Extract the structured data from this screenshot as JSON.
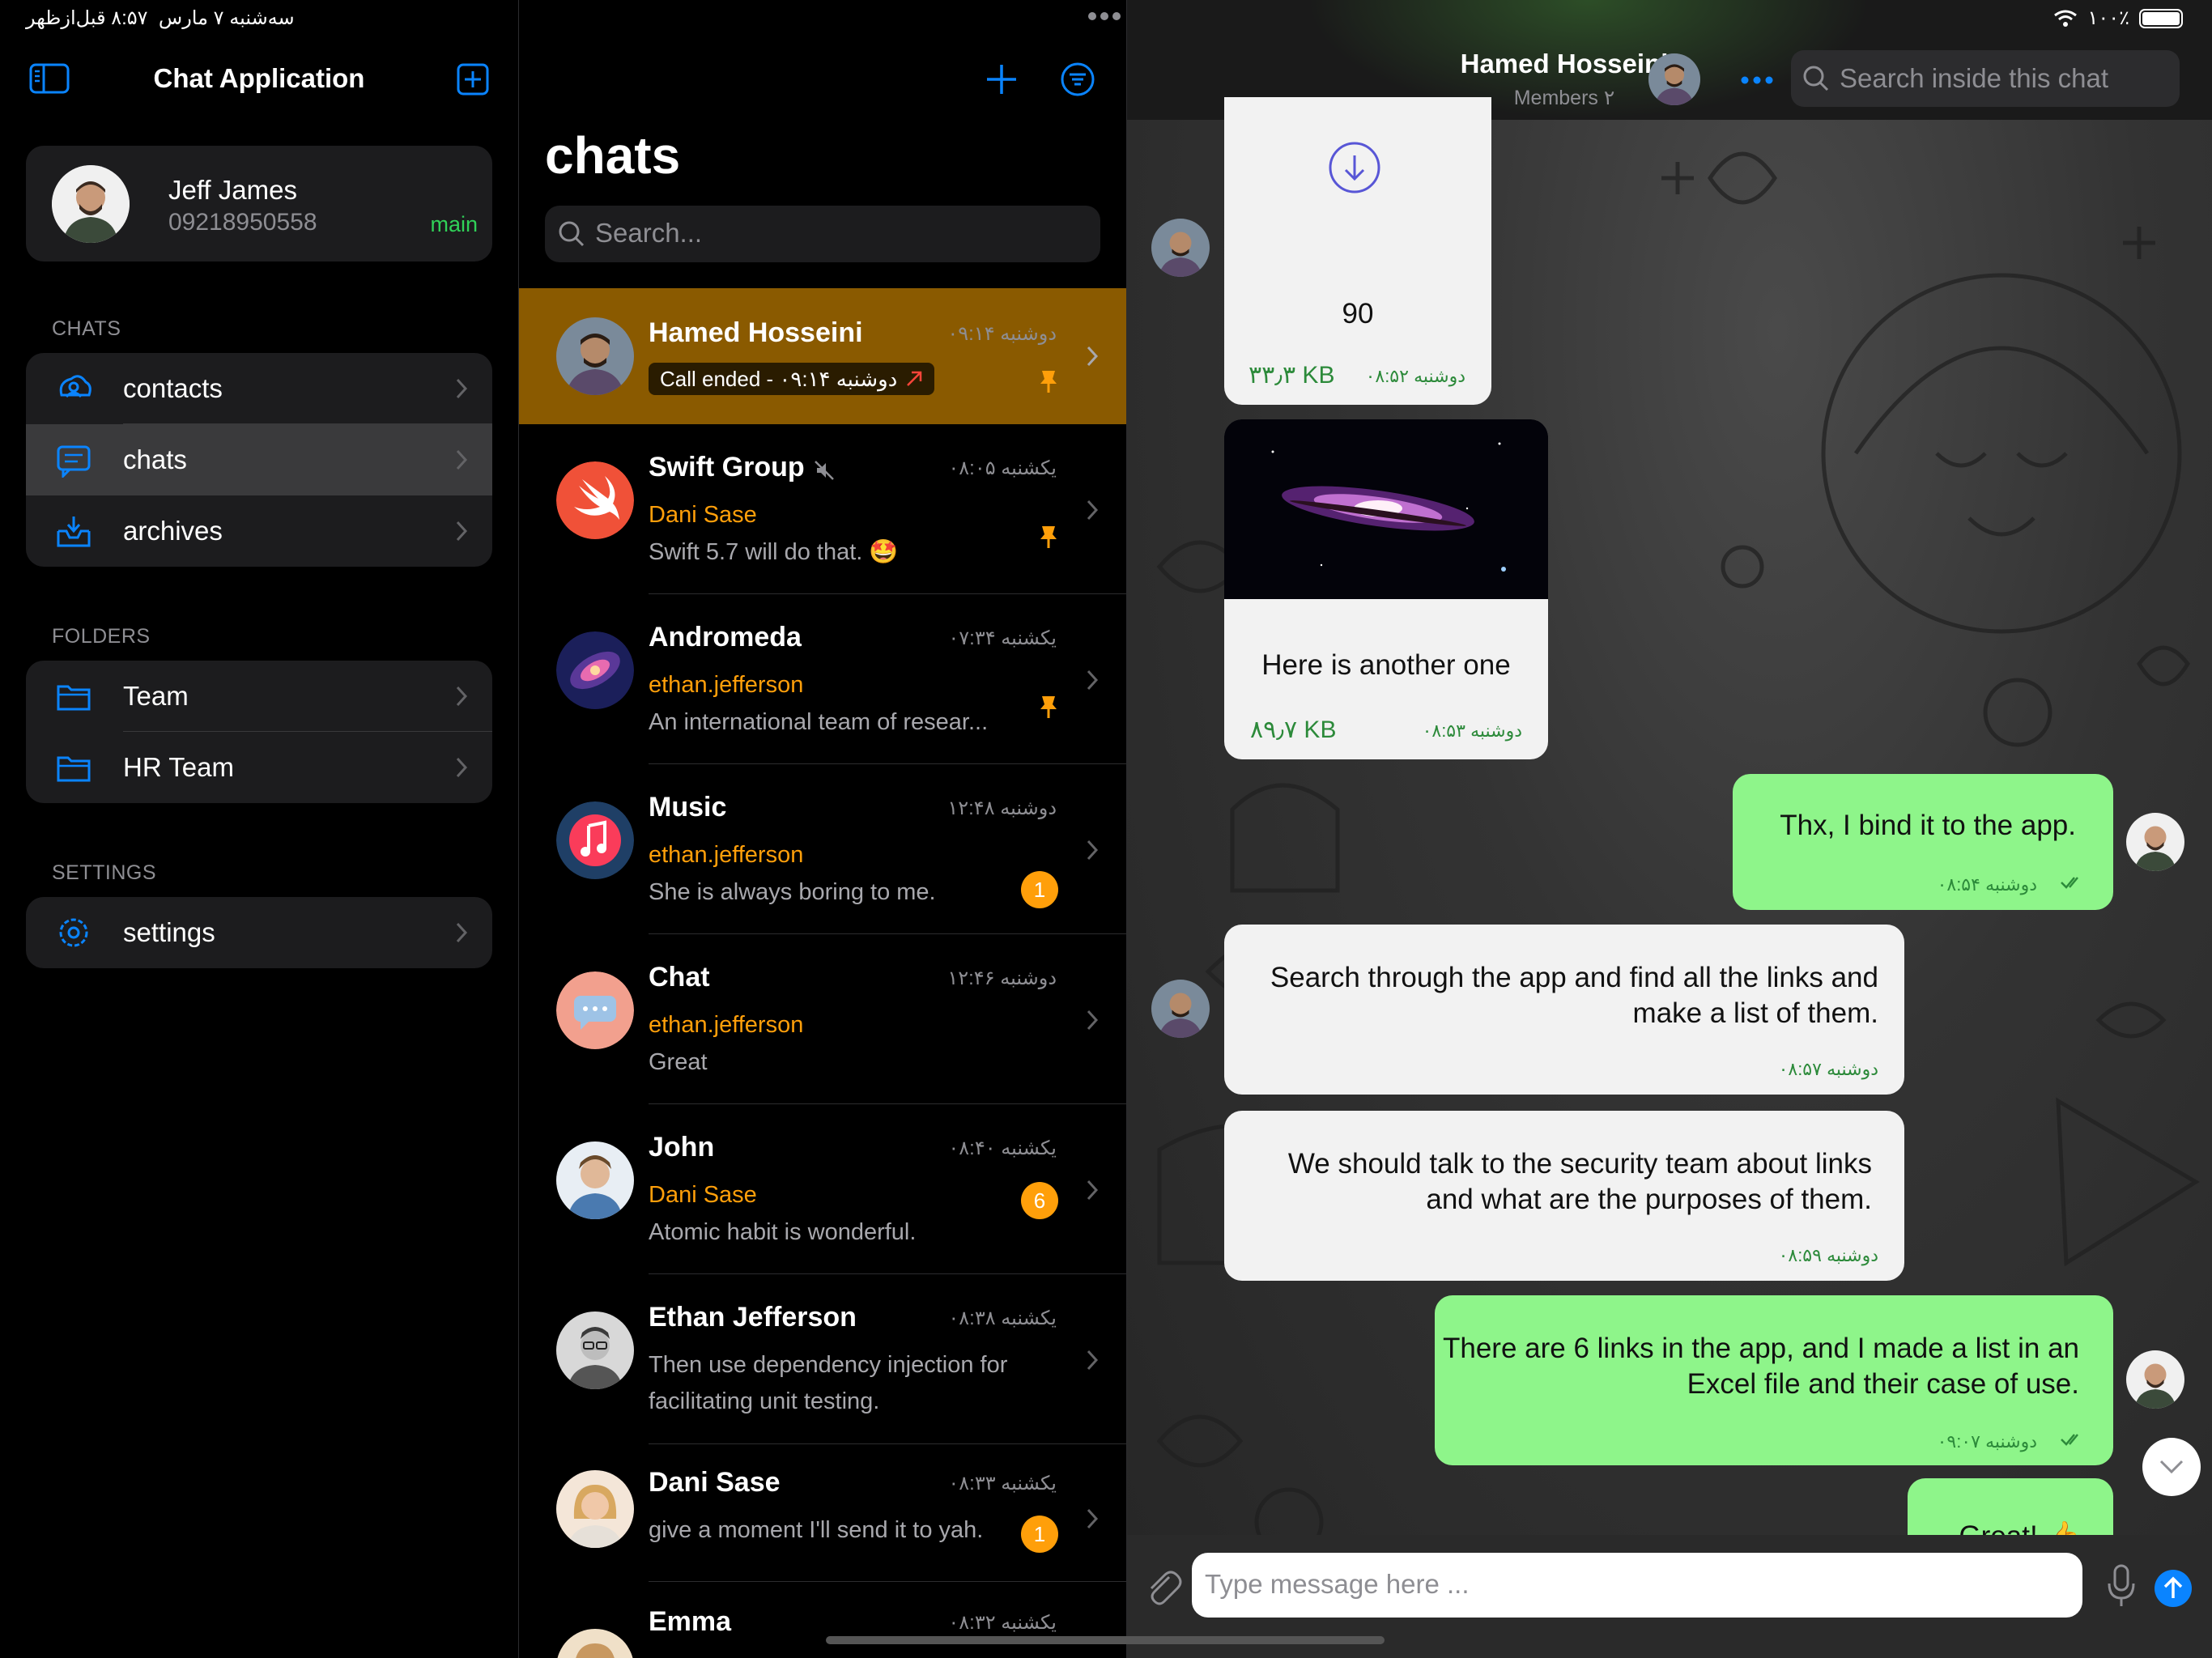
{
  "status_bar": {
    "time": "۸:۵۷ قبل‌ازظهر",
    "date": "سه‌شنبه ۷ مارس",
    "battery": "۱۰۰٪"
  },
  "sidebar": {
    "title": "Chat Application",
    "profile": {
      "name": "Jeff James",
      "phone": "09218950558",
      "tag": "main"
    },
    "sections": [
      {
        "label": "CHATS",
        "items": [
          {
            "label": "contacts"
          },
          {
            "label": "chats"
          },
          {
            "label": "archives"
          }
        ]
      },
      {
        "label": "FOLDERS",
        "items": [
          {
            "label": "Team"
          },
          {
            "label": "HR Team"
          }
        ]
      },
      {
        "label": "SETTINGS",
        "items": [
          {
            "label": "settings"
          }
        ]
      }
    ]
  },
  "list": {
    "title": "chats",
    "search_placeholder": "Search...",
    "chats": [
      {
        "name": "Hamed Hosseini",
        "time": "دوشنبه ۰۹:۱۴",
        "call_status": "Call ended - دوشنبه ۰۹:۱۴",
        "pinned": true,
        "selected": true
      },
      {
        "name": "Swift Group",
        "time": "یکشنبه ۰۸:۰۵",
        "sender": "Dani Sase",
        "message": "Swift 5.7 will do that. 🤩",
        "pinned": true,
        "muted": true
      },
      {
        "name": "Andromeda",
        "time": "یکشنبه ۰۷:۳۴",
        "sender": "ethan.jefferson",
        "message": "An international team of resear...",
        "pinned": true
      },
      {
        "name": "Music",
        "time": "دوشنبه ۱۲:۴۸",
        "sender": "ethan.jefferson",
        "message": "She is always boring to me.",
        "unread": "1"
      },
      {
        "name": "Chat",
        "time": "دوشنبه ۱۲:۴۶",
        "sender": "ethan.jefferson",
        "message": "Great"
      },
      {
        "name": "John",
        "time": "یکشنبه ۰۸:۴۰",
        "sender": "Dani Sase",
        "message": "Atomic habit is wonderful.",
        "unread": "6"
      },
      {
        "name": "Ethan Jefferson",
        "time": "یکشنبه ۰۸:۳۸",
        "message": "Then use dependency injection for facilitating unit testing."
      },
      {
        "name": "Dani Sase",
        "time": "یکشنبه ۰۸:۳۳",
        "message": "give a moment I'll send it to yah.",
        "unread": "1"
      },
      {
        "name": "Emma",
        "time": "یکشنبه ۰۸:۳۲"
      }
    ]
  },
  "conversation": {
    "title": "Hamed Hosseini",
    "subtitle": "Members ۲",
    "search_placeholder": "Search inside this chat",
    "messages": [
      {
        "type": "file",
        "text": "90",
        "size": "۳۳٫۳ KB",
        "time": "دوشنبه ۰۸:۵۲"
      },
      {
        "type": "image",
        "text": "Here is another one",
        "size": "۸۹٫۷ KB",
        "time": "دوشنبه ۰۸:۵۳"
      },
      {
        "type": "out",
        "text": "Thx, I bind it to the app.",
        "time": "دوشنبه ۰۸:۵۴"
      },
      {
        "type": "in",
        "text": "Search through the app and find all the links and make a list of them.",
        "time": "دوشنبه ۰۸:۵۷"
      },
      {
        "type": "in",
        "text": "We should talk to the security team about links and what are the purposes of them.",
        "time": "دوشنبه ۰۸:۵۹"
      },
      {
        "type": "out",
        "text": "There are 6 links in the app, and I made a list in an Excel file and their case of use.",
        "time": "دوشنبه ۰۹:۰۷"
      },
      {
        "type": "out",
        "text": "Great! 👍"
      }
    ],
    "composer_placeholder": "Type message here ..."
  },
  "colors": {
    "accent": "#0a84ff",
    "orange": "#ff9f0a",
    "selected_row": "#8a5a00",
    "bubble_out": "#8ef58a",
    "bubble_in": "#f2f2f2"
  }
}
